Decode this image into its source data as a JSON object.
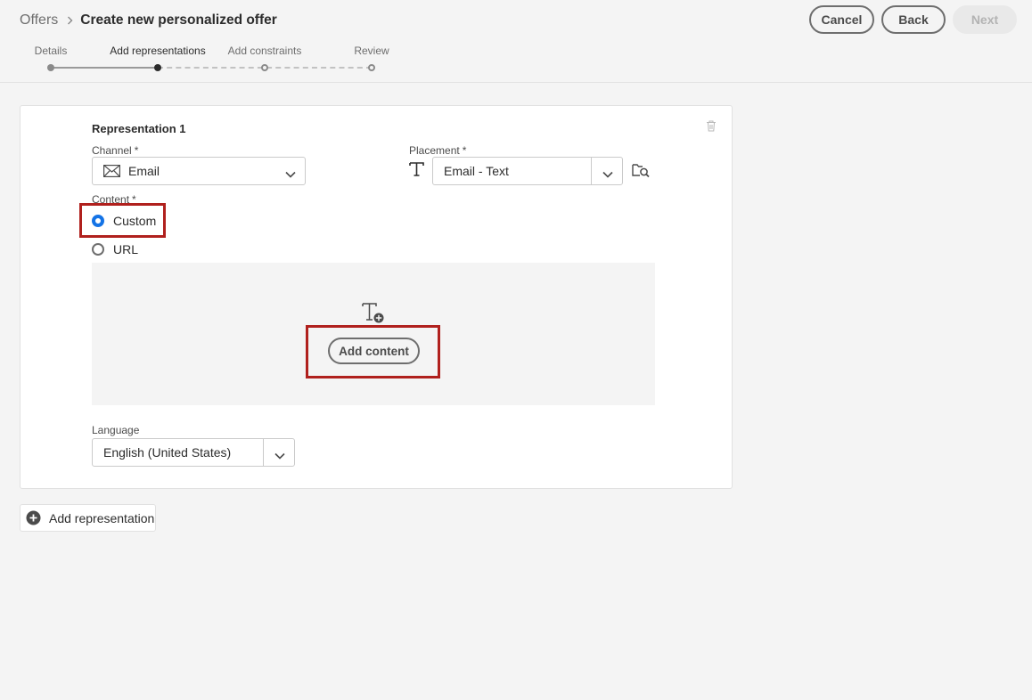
{
  "header": {
    "breadcrumb_root": "Offers",
    "page_title": "Create new personalized offer",
    "cancel_label": "Cancel",
    "back_label": "Back",
    "next_label": "Next"
  },
  "steps": [
    {
      "label": "Details",
      "state": "done"
    },
    {
      "label": "Add representations",
      "state": "current"
    },
    {
      "label": "Add constraints",
      "state": "todo"
    },
    {
      "label": "Review",
      "state": "todo"
    }
  ],
  "representation": {
    "title": "Representation 1",
    "channel_label": "Channel",
    "channel_value": "Email",
    "placement_label": "Placement",
    "placement_value": "Email - Text",
    "content_label": "Content",
    "required_mark": "*",
    "options": [
      {
        "label": "Custom",
        "selected": true
      },
      {
        "label": "URL",
        "selected": false
      }
    ],
    "add_content_label": "Add content",
    "language_label": "Language",
    "language_value": "English (United States)"
  },
  "add_representation_label": "Add representation",
  "colors": {
    "accent_blue": "#1473e6",
    "highlight_red": "#b0201d",
    "background": "#f4f4f4"
  }
}
